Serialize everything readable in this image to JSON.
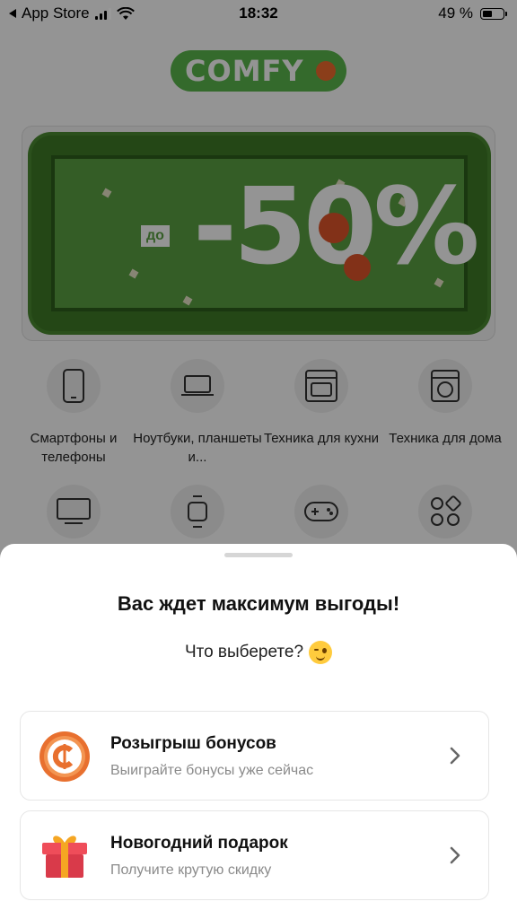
{
  "status_bar": {
    "back_app": "App Store",
    "time": "18:32",
    "battery": "49 %",
    "battery_level": 0.49
  },
  "brand": {
    "logo_text": "COMFY",
    "accent_green": "#5bb74d",
    "accent_orange": "#ef6b2e"
  },
  "banner": {
    "prefix": "до",
    "discount": "-50%"
  },
  "categories": [
    {
      "label": "Смартфоны и телефоны",
      "icon": "smartphone-icon"
    },
    {
      "label": "Ноутбуки, планшеты и...",
      "icon": "laptop-icon"
    },
    {
      "label": "Техника для кухни",
      "icon": "oven-icon"
    },
    {
      "label": "Техника для дома",
      "icon": "washing-machine-icon"
    },
    {
      "label": "",
      "icon": "tv-icon"
    },
    {
      "label": "",
      "icon": "smartwatch-icon"
    },
    {
      "label": "",
      "icon": "gamepad-icon"
    },
    {
      "label": "",
      "icon": "more-categories-icon"
    }
  ],
  "sheet": {
    "title": "Вас ждет максимум выгоды!",
    "subtitle": "Что выберете?",
    "subtitle_emoji": "winking-face-icon",
    "options": [
      {
        "title": "Розыгрыш бонусов",
        "description": "Выиграйте бонусы уже сейчас",
        "icon": "bonus-coin-icon"
      },
      {
        "title": "Новогодний подарок",
        "description": "Получите крутую скидку",
        "icon": "gift-box-icon"
      }
    ]
  }
}
